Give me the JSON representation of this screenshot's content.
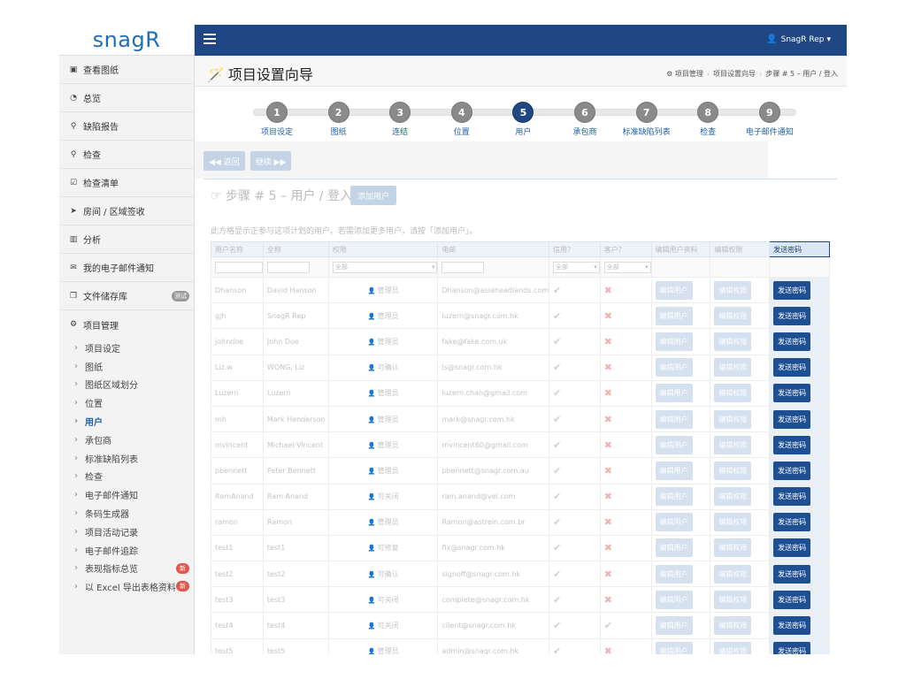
{
  "app": {
    "logo": "snagR"
  },
  "sidebar": {
    "items": [
      {
        "icon": "image-icon",
        "glyph": "▣",
        "label": "查看图纸"
      },
      {
        "icon": "dashboard-icon",
        "glyph": "◔",
        "label": "总览"
      },
      {
        "icon": "map-marker-icon",
        "glyph": "⚲",
        "label": "缺陷报告"
      },
      {
        "icon": "search-icon",
        "glyph": "⚲",
        "label": "检查"
      },
      {
        "icon": "checkbox-icon",
        "glyph": "☑",
        "label": "检查清单"
      },
      {
        "icon": "location-arrow-icon",
        "glyph": "➤",
        "label": "房间 / 区域签收"
      },
      {
        "icon": "bar-chart-icon",
        "glyph": "▥",
        "label": "分析"
      },
      {
        "icon": "envelope-icon",
        "glyph": "✉",
        "label": "我的电子邮件通知"
      },
      {
        "icon": "copy-icon",
        "glyph": "❐",
        "label": "文件储存库",
        "badge": "测试"
      }
    ],
    "group": {
      "icon": "cogs-icon",
      "glyph": "⚙",
      "label": "项目管理",
      "items": [
        {
          "label": "项目设定"
        },
        {
          "label": "图纸"
        },
        {
          "label": "图纸区域划分"
        },
        {
          "label": "位置"
        },
        {
          "label": "用户",
          "active": true
        },
        {
          "label": "承包商"
        },
        {
          "label": "标准缺陷列表"
        },
        {
          "label": "检查"
        },
        {
          "label": "电子邮件通知"
        },
        {
          "label": "条码生成器"
        },
        {
          "label": "项目活动记录"
        },
        {
          "label": "电子邮件追踪"
        },
        {
          "label": "表现指标总览",
          "badge": "新"
        },
        {
          "label": "以 Excel 导出表格资料",
          "badge": "新"
        }
      ]
    }
  },
  "topbar": {
    "user": "SnagR Rep",
    "caret": "▾"
  },
  "header": {
    "title": "项目设置向导",
    "breadcrumbs": [
      "项目管理",
      "项目设置向导",
      "步骤 # 5 – 用户 / 登入"
    ]
  },
  "wizard": {
    "steps": [
      {
        "num": "1",
        "label": "项目设定"
      },
      {
        "num": "2",
        "label": "图纸"
      },
      {
        "num": "3",
        "label": "连结"
      },
      {
        "num": "4",
        "label": "位置"
      },
      {
        "num": "5",
        "label": "用户",
        "active": true
      },
      {
        "num": "6",
        "label": "承包商"
      },
      {
        "num": "7",
        "label": "标准缺陷列表"
      },
      {
        "num": "8",
        "label": "检查"
      },
      {
        "num": "9",
        "label": "电子邮件通知"
      }
    ],
    "back_label": "◀◀ 返回",
    "next_label": "继续 ▶▶"
  },
  "content": {
    "step_title": "☞ 步骤 # 5 – 用户 / 登入",
    "add_user": "添加用户",
    "description": "此方格显示正参与这项计划的用户。若需添加更多用户，请按「添加用户」。"
  },
  "table": {
    "headers": [
      "用户名称",
      "全称",
      "权限",
      "电邮",
      "信用？",
      "客户？",
      "编辑用户资料",
      "编辑权限",
      "发送密码"
    ],
    "filter_all": "全部",
    "edit_user": "编辑用户",
    "edit_perm": "编辑权限",
    "send_pw": "发送密码",
    "rows": [
      {
        "user": "Dhanson",
        "name": "David Hanson",
        "role": "管理员",
        "email": "Dhanson@asiaheadlands.com",
        "credit": "tick",
        "client": "cross"
      },
      {
        "user": "gjh",
        "name": "SnagR Rep",
        "role": "管理员",
        "email": "luzern@snagr.com.hk",
        "credit": "tick",
        "client": "cross"
      },
      {
        "user": "johndoe",
        "name": "John Doe",
        "role": "管理员",
        "email": "fake@fake.com.uk",
        "credit": "tick",
        "client": "cross"
      },
      {
        "user": "Liz.w",
        "name": "WONG, Liz",
        "role": "可确认",
        "email": "ls@snagr.com.hk",
        "credit": "tick",
        "client": "cross"
      },
      {
        "user": "Luzern",
        "name": "Luzern",
        "role": "管理员",
        "email": "luzern.chan@gmail.com",
        "credit": "tick",
        "client": "cross"
      },
      {
        "user": "mh",
        "name": "Mark Henderson",
        "role": "管理员",
        "email": "mark@snagr.com.hk",
        "credit": "tick",
        "client": "cross"
      },
      {
        "user": "mvincent",
        "name": "Michael Vincent",
        "role": "管理员",
        "email": "mvincent60@gmail.com",
        "credit": "tick",
        "client": "cross"
      },
      {
        "user": "pbennett",
        "name": "Peter Bennett",
        "role": "管理员",
        "email": "pbennett@snagr.com.au",
        "credit": "tick",
        "client": "cross"
      },
      {
        "user": "RamAnand",
        "name": "Ram Anand",
        "role": "可关闭",
        "email": "ram.anand@vel.com",
        "credit": "tick",
        "client": "cross"
      },
      {
        "user": "ramon",
        "name": "Ramon",
        "role": "管理员",
        "email": "Ramon@astrein.com.br",
        "credit": "tick",
        "client": "cross"
      },
      {
        "user": "test1",
        "name": "test1",
        "role": "可修复",
        "email": "fix@snagr.com.hk",
        "credit": "tick",
        "client": "cross"
      },
      {
        "user": "test2",
        "name": "test2",
        "role": "可确认",
        "email": "signoff@snagr.com.hk",
        "credit": "tick",
        "client": "cross"
      },
      {
        "user": "test3",
        "name": "test3",
        "role": "可关闭",
        "email": "complete@snagr.com.hk",
        "credit": "tick",
        "client": "cross"
      },
      {
        "user": "test4",
        "name": "test4",
        "role": "可关闭",
        "email": "client@snagr.com.hk",
        "credit": "tick",
        "client": "tick"
      },
      {
        "user": "test5",
        "name": "test5",
        "role": "管理员",
        "email": "admin@snagr.com.hk",
        "credit": "tick",
        "client": "cross"
      }
    ]
  },
  "colors": {
    "brand": "#1f4784",
    "logo": "#1f6fb7",
    "send": "#1f4f93",
    "new_badge": "#e2574c"
  }
}
